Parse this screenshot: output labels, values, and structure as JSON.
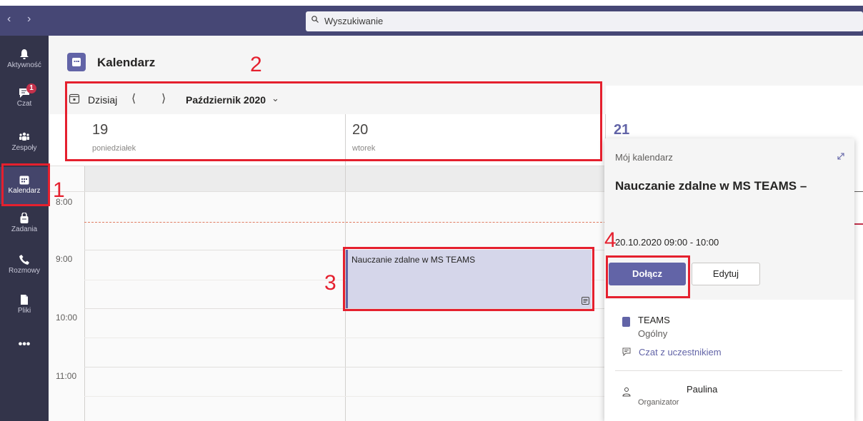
{
  "search": {
    "placeholder": "Wyszukiwanie"
  },
  "rail": {
    "items": [
      {
        "label": "Aktywność",
        "icon": "bell-icon"
      },
      {
        "label": "Czat",
        "icon": "chat-icon",
        "badge": "1"
      },
      {
        "label": "Zespoły",
        "icon": "teams-icon"
      },
      {
        "label": "Kalendarz",
        "icon": "calendar-icon",
        "active": true
      },
      {
        "label": "Zadania",
        "icon": "assignments-icon"
      },
      {
        "label": "Rozmowy",
        "icon": "phone-icon"
      },
      {
        "label": "Pliki",
        "icon": "file-icon"
      },
      {
        "label": "•••",
        "icon": "more-icon"
      }
    ]
  },
  "header": {
    "title": "Kalendarz"
  },
  "toolbar": {
    "today": "Dzisiaj",
    "month": "Październik 2020"
  },
  "days": [
    {
      "num": "19",
      "name": "poniedziałek"
    },
    {
      "num": "20",
      "name": "wtorek"
    },
    {
      "num": "21",
      "name": ""
    }
  ],
  "times": [
    "8:00",
    "9:00",
    "10:00",
    "11:00"
  ],
  "event": {
    "title": "Nauczanie zdalne w MS TEAMS"
  },
  "card": {
    "calendar_label": "Mój kalendarz",
    "title": "Nauczanie zdalne w MS TEAMS –",
    "datetime": "20.10.2020 09:00 - 10:00",
    "join_label": "Dołącz",
    "edit_label": "Edytuj",
    "team": "TEAMS",
    "channel": "Ogólny",
    "chat_link": "Czat z uczestnikiem",
    "person_name": "Paulina",
    "person_role": "Organizator"
  },
  "annotations": [
    "1",
    "2",
    "3",
    "4"
  ],
  "colors": {
    "accent": "#6264a7",
    "rail": "#33344a",
    "topbar": "#464775",
    "annotation": "#e5202e"
  }
}
